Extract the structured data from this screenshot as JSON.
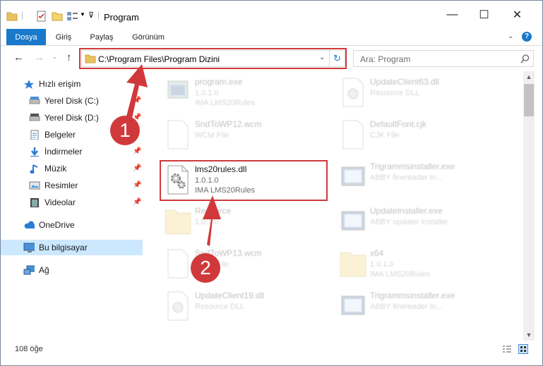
{
  "window": {
    "title": "Program"
  },
  "window_controls": {
    "minimize": "—",
    "maximize": "☐",
    "close": "✕"
  },
  "ribbon": {
    "tabs": [
      {
        "label": "Dosya"
      },
      {
        "label": "Giriş"
      },
      {
        "label": "Paylaş"
      },
      {
        "label": "Görünüm"
      }
    ],
    "help": "?"
  },
  "address": {
    "path": "C:\\Program Files\\Program Dizini"
  },
  "search": {
    "placeholder": "Ara: Program"
  },
  "sidebar": {
    "items": [
      {
        "label": "Hızlı erişim",
        "icon": "star-icon"
      },
      {
        "label": "Yerel Disk (C:)",
        "icon": "drive-icon"
      },
      {
        "label": "Yerel Disk (D:)",
        "icon": "drive-icon"
      },
      {
        "label": "Belgeler",
        "icon": "document-icon"
      },
      {
        "label": "İndirmeler",
        "icon": "download-icon"
      },
      {
        "label": "Müzik",
        "icon": "music-icon"
      },
      {
        "label": "Resimler",
        "icon": "pictures-icon"
      },
      {
        "label": "Videolar",
        "icon": "video-icon"
      },
      {
        "label": "OneDrive",
        "icon": "cloud-icon"
      },
      {
        "label": "Bu bilgisayar",
        "icon": "computer-icon"
      },
      {
        "label": "Ağ",
        "icon": "network-icon"
      }
    ]
  },
  "files": {
    "items": [
      {
        "name": "program.exe",
        "version": "1.0.1.0",
        "desc": "IMA LMS20Rules"
      },
      {
        "name": "UpdateClient63.dll",
        "version": "",
        "desc": "Resource DLL"
      },
      {
        "name": "SndToWP12.wcm",
        "version": "",
        "desc": "WCM File"
      },
      {
        "name": "DefaultFont.cjk",
        "version": "",
        "desc": "CJK File"
      },
      {
        "name": "lms20rules.dll",
        "version": "1.0.1.0",
        "desc": "IMA LMS20Rules"
      },
      {
        "name": "Trigrammsinstaller.exe",
        "version": "",
        "desc": "ABBY finereader tn..."
      },
      {
        "name": "Resource",
        "version": "1.0.1.0",
        "desc": ""
      },
      {
        "name": "UpdateInstaller.exe",
        "version": "",
        "desc": "ABBY updater installer"
      },
      {
        "name": "SndToWP13.wcm",
        "version": "",
        "desc": "WCM File"
      },
      {
        "name": "x64",
        "version": "1.0.1.0",
        "desc": "IMA LMS20Rules"
      },
      {
        "name": "UpdateClient19.dll",
        "version": "",
        "desc": "Resource DLL"
      },
      {
        "name": "Trigrammsinstaller.exe",
        "version": "",
        "desc": "ABBY finereader tn..."
      }
    ]
  },
  "status": {
    "item_count": "108 öğe"
  },
  "annotations": {
    "step1": "1",
    "step2": "2"
  },
  "colors": {
    "accent": "#1979ca",
    "highlight": "#d0393b",
    "selected": "#cce8ff"
  }
}
